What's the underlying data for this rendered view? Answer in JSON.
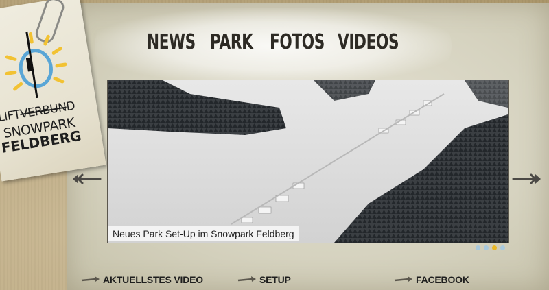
{
  "nav": {
    "items": [
      "NEWS",
      "PARK",
      "FOTOS",
      "VIDEOS"
    ]
  },
  "logo": {
    "line1_a": "LIFT",
    "line1_strike": "VERBUN",
    "line1_b": "D",
    "line2": "SNOWPARK",
    "line3": "FELDBERG",
    "colors": {
      "sun": "#f2c233",
      "ring": "#5aa6d6"
    }
  },
  "slider": {
    "caption": "Neues Park Set-Up im Snowpark Feldberg",
    "dots": [
      false,
      false,
      true,
      false
    ],
    "prev_icon": "arrow-left-icon",
    "next_icon": "arrow-right-icon"
  },
  "sections": {
    "video": "AKTUELLSTES VIDEO",
    "setup": "SETUP",
    "facebook": "FACEBOOK"
  }
}
